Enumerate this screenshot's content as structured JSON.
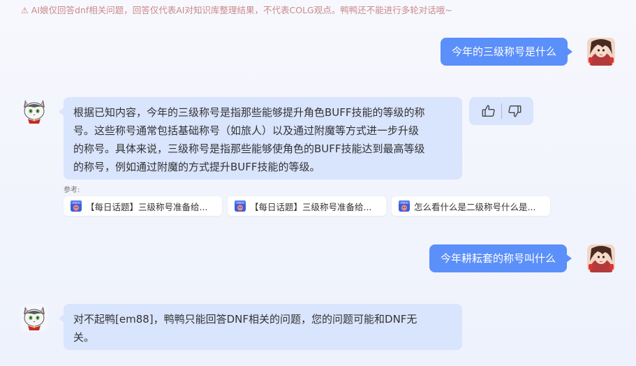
{
  "notice": {
    "icon": "warning-icon",
    "text": "AI娘仅回答dnf相关问题，回答仅代表AI对知识库整理结果，不代表COLG观点。鸭鸭还不能进行多轮对话哦~"
  },
  "conversation": [
    {
      "role": "user",
      "text": "今年的三级称号是什么"
    },
    {
      "role": "assistant",
      "lines": [
        "根据已知内容，今年的三级称号是指那些能够提升角色BUFF技能的等级的称",
        "号。这些称号通常包括基础称号（如旅人）以及通过附魔等方式进一步升级",
        "的称号。具体来说，三级称号是指那些能够使角色的BUFF技能达到最高等级",
        "的称号，例如通过附魔的方式提升BUFF技能的等级。"
      ]
    },
    {
      "role": "user",
      "text": "今年耕耘套的称号叫什么"
    },
    {
      "role": "assistant",
      "lines": [
        "对不起鸭[em88]，鸭鸭只能回答DNF相关的问题，您的问题可能和DNF无",
        "关。"
      ]
    }
  ],
  "references": {
    "label": "参考:",
    "items": [
      {
        "icon": "colg-icon",
        "title": "【每日话题】三级称号准备给..."
      },
      {
        "icon": "colg-icon",
        "title": "【每日话题】三级称号准备给..."
      },
      {
        "icon": "colg-icon",
        "title": "怎么看什么是二级称号什么是..."
      }
    ]
  },
  "feedback": {
    "like_icon": "thumbs-up-icon",
    "dislike_icon": "thumbs-down-icon"
  },
  "colors": {
    "user_bubble": "#5b8ff9",
    "bot_bubble": "#d9e4fd",
    "notice_text": "#c98a8a"
  }
}
